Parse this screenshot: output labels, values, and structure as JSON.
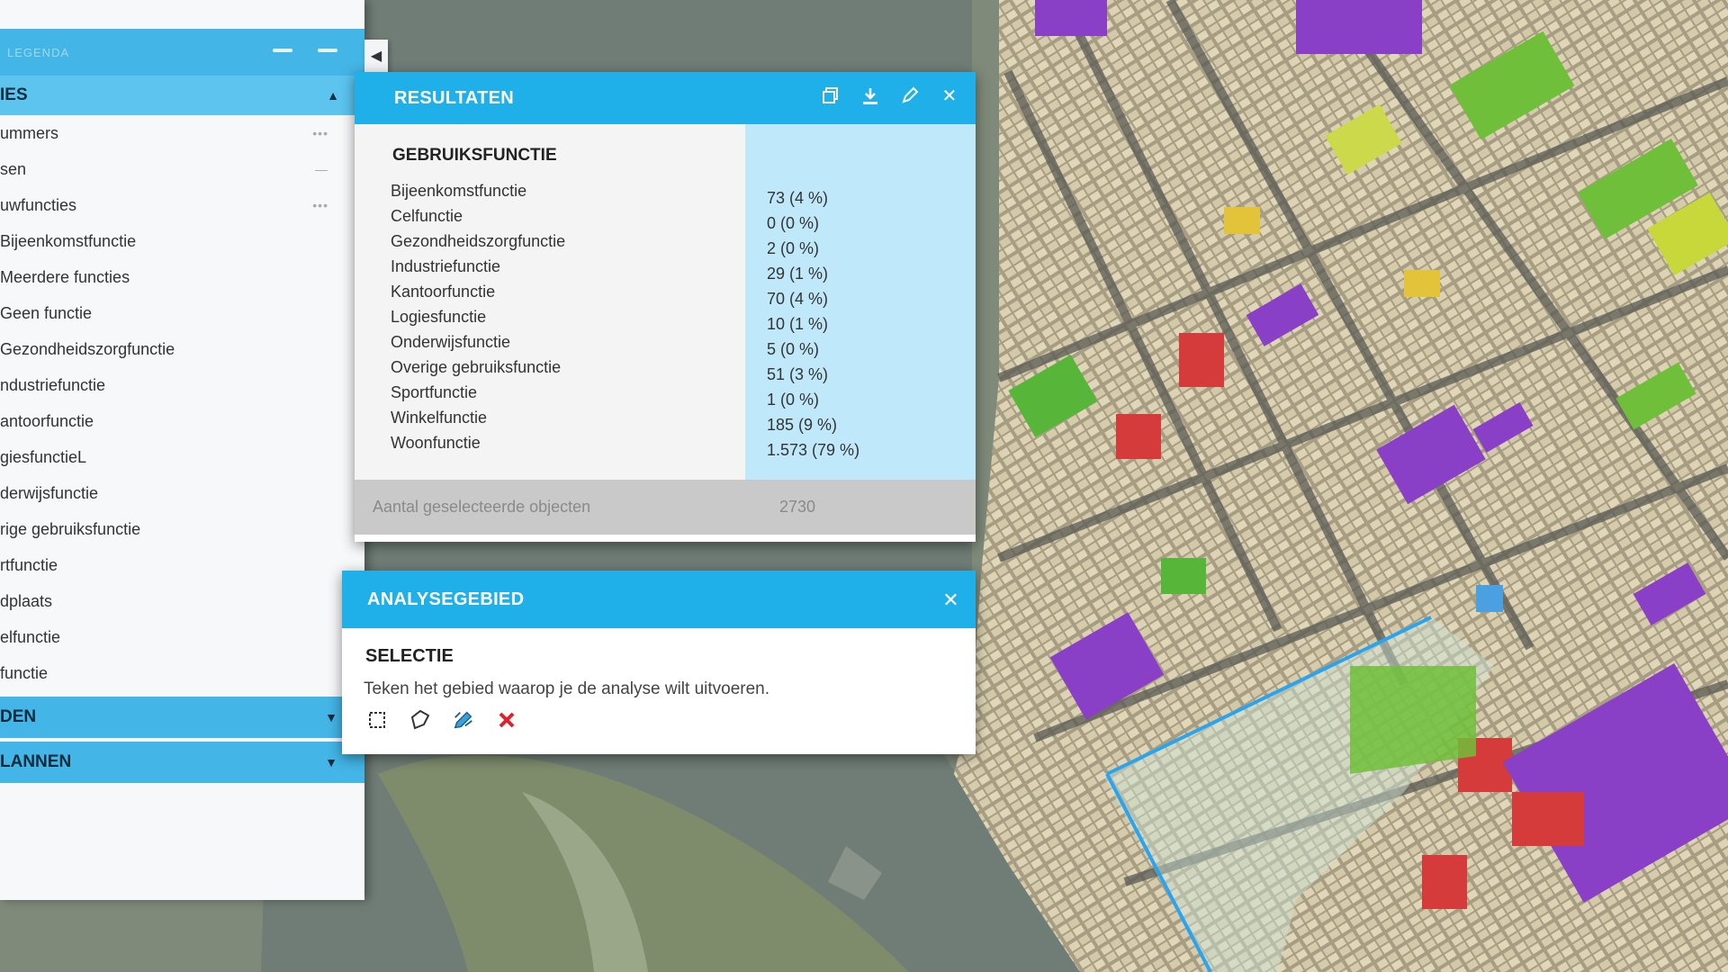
{
  "left_panel": {
    "header_title": "LEGENDA",
    "section_open": "IES",
    "items": [
      {
        "label": "ummers",
        "dots": "•••"
      },
      {
        "label": "sen",
        "dots": "—"
      },
      {
        "label": "uwfuncties",
        "dots": "•••"
      },
      {
        "label": "Bijeenkomstfunctie",
        "dots": ""
      },
      {
        "label": "Meerdere functies",
        "dots": ""
      },
      {
        "label": "Geen functie",
        "dots": ""
      },
      {
        "label": "Gezondheidszorgfunctie",
        "dots": ""
      },
      {
        "label": "ndustriefunctie",
        "dots": ""
      },
      {
        "label": "antoorfunctie",
        "dots": ""
      },
      {
        "label": "giesfunctieL",
        "dots": ""
      },
      {
        "label": "derwijsfunctie",
        "dots": ""
      },
      {
        "label": "rige gebruiksfunctie",
        "dots": ""
      },
      {
        "label": "rtfunctie",
        "dots": ""
      },
      {
        "label": "dplaats",
        "dots": ""
      },
      {
        "label": "elfunctie",
        "dots": ""
      },
      {
        "label": "functie",
        "dots": ""
      }
    ],
    "section_2": "DEN",
    "section_3": "LANNEN"
  },
  "resultaten": {
    "title": "RESULTATEN",
    "table_title": "GEBRUIKSFUNCTIE",
    "rows": [
      {
        "label": "Bijeenkomstfunctie",
        "value": "73 (4 %)"
      },
      {
        "label": "Celfunctie",
        "value": "0 (0 %)"
      },
      {
        "label": "Gezondheidszorgfunctie",
        "value": "2 (0 %)"
      },
      {
        "label": "Industriefunctie",
        "value": "29 (1 %)"
      },
      {
        "label": "Kantoorfunctie",
        "value": "70 (4 %)"
      },
      {
        "label": "Logiesfunctie",
        "value": "10 (1 %)"
      },
      {
        "label": "Onderwijsfunctie",
        "value": "5 (0 %)"
      },
      {
        "label": "Overige gebruiksfunctie",
        "value": "51 (3 %)"
      },
      {
        "label": "Sportfunctie",
        "value": "1 (0 %)"
      },
      {
        "label": "Winkelfunctie",
        "value": "185 (9 %)"
      },
      {
        "label": "Woonfunctie",
        "value": "1.573 (79 %)"
      }
    ],
    "footer_label": "Aantal geselecteerde objecten",
    "footer_value": "2730"
  },
  "analysegebied": {
    "title": "ANALYSEGEBIED",
    "selection_title": "SELECTIE",
    "description": "Teken het gebied waarop je de analyse wilt uitvoeren.",
    "tools": [
      "rectangle-icon",
      "polygon-icon",
      "edit-icon",
      "delete-icon"
    ]
  },
  "colors": {
    "header_blue": "#1fb0e9",
    "section_blue": "#5cc4ef",
    "value_column": "#bfe9fb",
    "woon": "#d9cfae",
    "winkel": "#8a3fc7",
    "kantoor": "#57b53a",
    "bijeenkomst": "#d53b3a",
    "selection_line": "#2aa4ee"
  }
}
